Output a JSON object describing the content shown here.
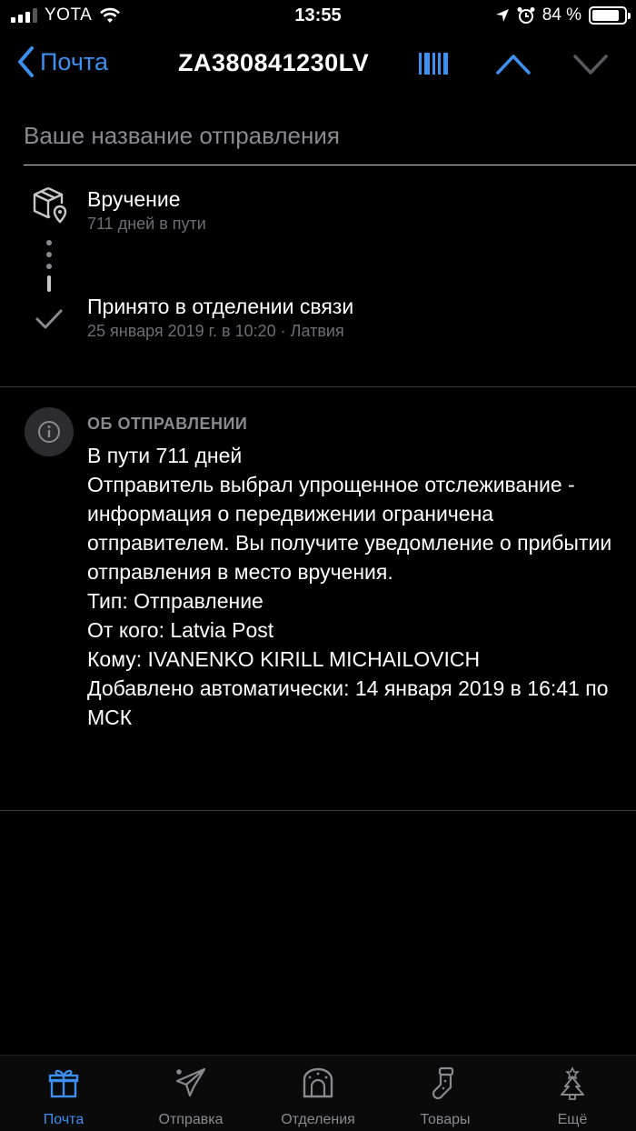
{
  "status_bar": {
    "carrier": "YOTA",
    "time": "13:55",
    "battery_percent": "84 %",
    "battery_level": 0.84
  },
  "nav": {
    "back_label": "Почта",
    "title": "ZA380841230LV"
  },
  "name_field": {
    "placeholder": "Ваше название отправления"
  },
  "timeline": [
    {
      "title": "Вручение",
      "subtitle": "711 дней в пути",
      "icon": "package-location-icon"
    },
    {
      "title": "Принято в отделении связи",
      "subtitle": "25 января 2019 г. в 10:20 · Латвия",
      "icon": "check-icon"
    }
  ],
  "about": {
    "heading": "ОБ ОТПРАВЛЕНИИ",
    "lines": [
      "В пути 711 дней",
      "Отправитель выбрал упрощенное отслеживание - информация о передвижении ограничена отправителем. Вы получите уведомление о прибытии отправления в место вручения.",
      "Тип: Отправление",
      "От кого: Latvia Post",
      "Кому: IVANENKO KIRILL MICHAILOVICH",
      "Добавлено автоматически: 14 января 2019 в 16:41 по МСК"
    ]
  },
  "tabs": [
    {
      "label": "Почта",
      "icon": "gift-icon",
      "active": true
    },
    {
      "label": "Отправка",
      "icon": "paper-plane-icon",
      "active": false
    },
    {
      "label": "Отделения",
      "icon": "post-office-icon",
      "active": false
    },
    {
      "label": "Товары",
      "icon": "stocking-icon",
      "active": false
    },
    {
      "label": "Ещё",
      "icon": "christmas-tree-icon",
      "active": false
    }
  ],
  "colors": {
    "accent": "#3d8ff0",
    "background": "#000000",
    "secondary_text": "#6e6e73"
  }
}
